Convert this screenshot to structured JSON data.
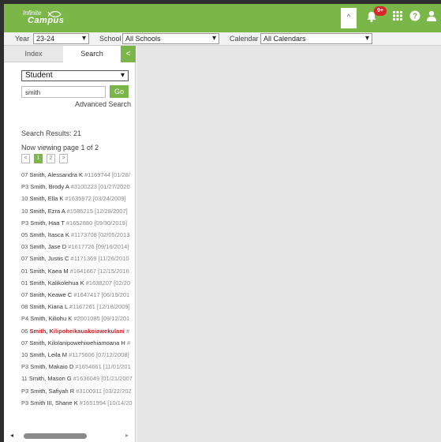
{
  "header": {
    "logo_top": "Infinite",
    "logo_bottom": "Campus",
    "collapse_glyph": "^",
    "notification_badge": "9+",
    "icons": [
      "bell-icon",
      "apps-grid-icon",
      "help-icon",
      "user-icon"
    ],
    "accent_color": "#7ab648"
  },
  "context": {
    "year_label": "Year",
    "year_value": "23-24",
    "school_label": "School",
    "school_value": "All Schools",
    "calendar_label": "Calendar",
    "calendar_value": "All Calendars"
  },
  "sidebar": {
    "tabs": {
      "index": "Index",
      "search": "Search",
      "collapse": "<"
    },
    "search_type": "Student",
    "search_value": "smith",
    "go_label": "Go",
    "advanced_link": "Advanced Search",
    "results_count": "Search Results: 21",
    "viewing": "Now viewing page 1 of 2",
    "pager": {
      "prev": "<",
      "page1": "1",
      "page2": "2",
      "next": ">"
    },
    "results": [
      {
        "grade": "07",
        "name": "Smith, Alessandra K",
        "meta": "#1169744 [01/28/"
      },
      {
        "grade": "P3",
        "name": "Smith, Brody A",
        "meta": "#3100223 [01/27/2020"
      },
      {
        "grade": "10",
        "name": "Smith, Ella K",
        "meta": "#1635972 [03/24/2009]"
      },
      {
        "grade": "10",
        "name": "Smith, Ezra A",
        "meta": "#1586215 [12/28/2007]"
      },
      {
        "grade": "P3",
        "name": "Smith, Haa T",
        "meta": "#1652880 [09/30/2019]"
      },
      {
        "grade": "05",
        "name": "Smith, Itasca K",
        "meta": "#1173708 [02/05/2013"
      },
      {
        "grade": "03",
        "name": "Smith, Jase D",
        "meta": "#1617726 [09/16/2014]"
      },
      {
        "grade": "07",
        "name": "Smith, Justis C",
        "meta": "#1171369 [11/26/2010"
      },
      {
        "grade": "01",
        "name": "Smith, Kaea M",
        "meta": "#1641667 [12/15/2016"
      },
      {
        "grade": "01",
        "name": "Smith, Kalikolehua K",
        "meta": "#1638207 [02/20"
      },
      {
        "grade": "07",
        "name": "Smith, Keawe C",
        "meta": "#1647417 [06/19/201"
      },
      {
        "grade": "08",
        "name": "Smith, Kiana L",
        "meta": "#1167261 [12/18/2009]"
      },
      {
        "grade": "P4",
        "name": "Smith, Kiliohu K",
        "meta": "#2001085 [09/12/201"
      },
      {
        "grade": "06",
        "name": "Smith, Kilipoheikauakoiawekulani",
        "meta": "#"
      },
      {
        "grade": "07",
        "name": "Smith, Kilolanipowehiwehiamoana H",
        "meta": "#"
      },
      {
        "grade": "10",
        "name": "Smith, Leila M",
        "meta": "#1175606 [07/12/2008]"
      },
      {
        "grade": "P3",
        "name": "Smith, Makaio D",
        "meta": "#1654661 [11/01/201"
      },
      {
        "grade": "11",
        "name": "Smith, Mason G",
        "meta": "#1636049 [01/21/2007"
      },
      {
        "grade": "P3",
        "name": "Smith, Safiyah R",
        "meta": "#3100911 [03/22/202"
      },
      {
        "grade": "P3",
        "name": "Smith III, Shane K",
        "meta": "#1651994 [10/14/20"
      }
    ],
    "highlighted_index": 13,
    "highlight_color": "#c8202a"
  },
  "scrollbar": {
    "left_arrow": "◂",
    "right_arrow": "▸"
  }
}
